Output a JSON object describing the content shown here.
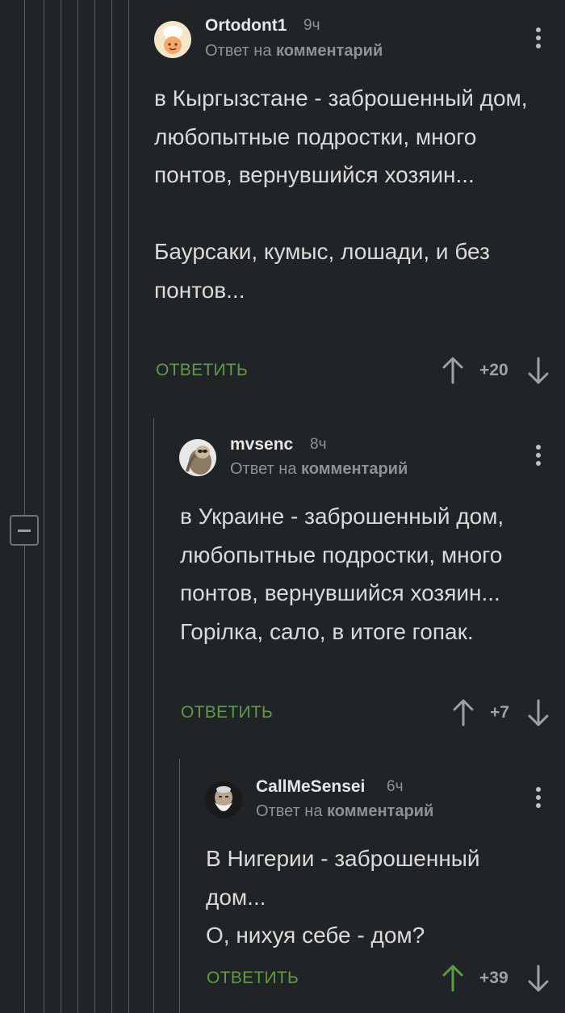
{
  "comments": [
    {
      "author": "Ortodont1",
      "time": "9ч",
      "reply_prefix": "Ответ на",
      "reply_target": "комментарий",
      "text": [
        "в Кыргызстане - заброшенный дом, любопытные подростки, много понтов, вернувшийся хозяин...",
        "",
        "Баурсаки, кумыс, лошади, и без понтов..."
      ],
      "reply_label": "ОТВЕТИТЬ",
      "score": "+20",
      "upvoted": false
    },
    {
      "author": "mvsenc",
      "time": "8ч",
      "reply_prefix": "Ответ на",
      "reply_target": "комментарий",
      "text": [
        "в Украине - заброшенный дом, любопытные подростки, много понтов, вернувшийся хозяин... Горілка, сало, в итоге гопак."
      ],
      "reply_label": "ОТВЕТИТЬ",
      "score": "+7",
      "upvoted": false
    },
    {
      "author": "CallMeSensei",
      "time": "6ч",
      "reply_prefix": "Ответ на",
      "reply_target": "комментарий",
      "text": [
        "В Нигерии - заброшенный дом...",
        "О, нихуя себе - дом?"
      ],
      "reply_label": "ОТВЕТИТЬ",
      "score": "+39",
      "upvoted": true
    }
  ],
  "colors": {
    "background": "#212426",
    "accent_green": "#5f9a45",
    "muted": "#8e9295"
  },
  "icons": [
    "chef-avatar",
    "sloth-avatar",
    "old-man-avatar",
    "more-vertical-icon",
    "arrow-up-icon",
    "arrow-down-icon",
    "collapse-minus-icon"
  ]
}
